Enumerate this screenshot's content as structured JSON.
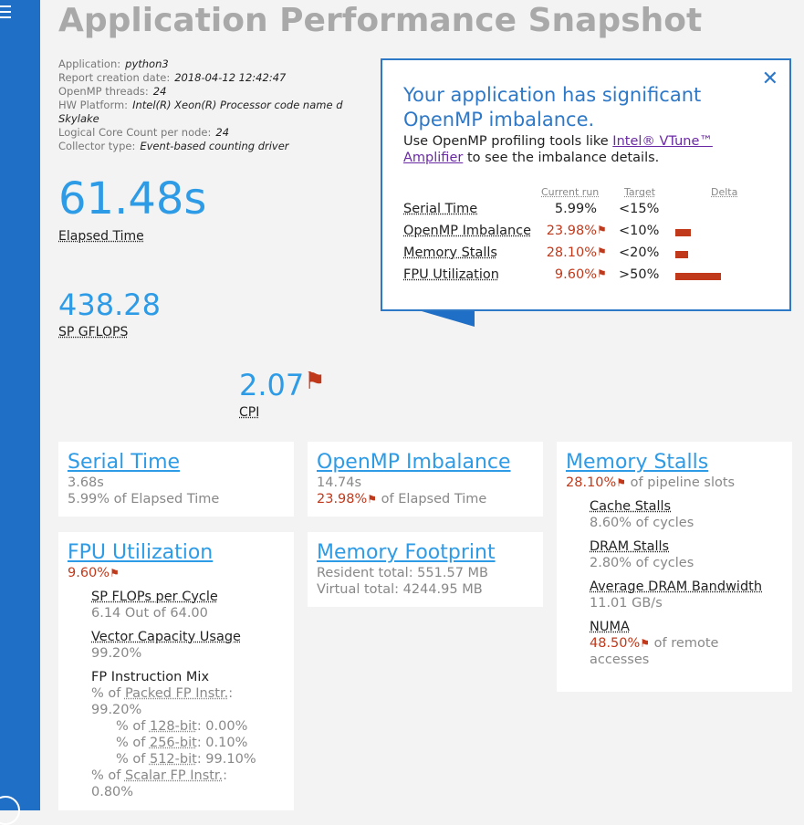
{
  "title": "Application Performance Snapshot",
  "meta": [
    {
      "key": "Application:",
      "value": "python3"
    },
    {
      "key": "Report creation date:",
      "value": "2018-04-12 12:42:47"
    },
    {
      "key": "OpenMP threads:",
      "value": "24"
    },
    {
      "key": "HW Platform:",
      "value": "Intel(R) Xeon(R) Processor code name d Skylake"
    },
    {
      "key": "Logical Core Count per node:",
      "value": "24"
    },
    {
      "key": "Collector type:",
      "value": "Event-based counting driver"
    }
  ],
  "elapsed": {
    "value": "61.48s",
    "label": "Elapsed Time"
  },
  "gflops": {
    "value": "438.28",
    "label": "SP GFLOPS"
  },
  "cpi": {
    "value": "2.07",
    "label": "CPI"
  },
  "serial": {
    "title": "Serial Time",
    "l1": "3.68s",
    "l2": "5.99% of Elapsed Time"
  },
  "omp": {
    "title": "OpenMP Imbalance",
    "l1": "14.74s",
    "pct": "23.98%",
    "suffix": "of Elapsed Time"
  },
  "memstalls": {
    "title": "Memory Stalls",
    "pct": "28.10%",
    "suffix": "of pipeline slots",
    "cache_label": "Cache Stalls",
    "cache_value": "8.60% of cycles",
    "dram_label": "DRAM Stalls",
    "dram_value": "2.80% of cycles",
    "bw_label": "Average DRAM Bandwidth",
    "bw_value": "11.01 GB/s",
    "numa_label": "NUMA",
    "numa_pct": "48.50%",
    "numa_suffix": "of remote",
    "numa_suffix2": "accesses"
  },
  "fpu": {
    "title": "FPU Utilization",
    "pct": "9.60%",
    "flops_label": "SP FLOPs per Cycle",
    "flops_value": "6.14 Out of 64.00",
    "vec_label": "Vector Capacity Usage",
    "vec_value": "99.20%",
    "mix_label": "FP Instruction Mix",
    "packed_prefix": "% of",
    "packed_label": "Packed FP Instr.",
    "packed_colon": ":",
    "packed_value": "99.20%",
    "b128_prefix": "% of",
    "b128_label": "128-bit",
    "b128_value": ": 0.00%",
    "b256_prefix": "% of",
    "b256_label": "256-bit",
    "b256_value": ": 0.10%",
    "b512_prefix": "% of",
    "b512_label": "512-bit",
    "b512_value": ": 99.10%",
    "scalar_prefix": "% of",
    "scalar_label": "Scalar FP Instr.",
    "scalar_colon": ":",
    "scalar_value": "0.80%"
  },
  "footprint": {
    "title": "Memory Footprint",
    "resident": "Resident total: 551.57 MB",
    "virtual": "Virtual total: 4244.95 MB"
  },
  "popup": {
    "heading": "Your application has significant OpenMP imbalance.",
    "desc_prefix": "Use OpenMP profiling tools like",
    "link": "Intel® VTune™ Amplifier",
    "desc_suffix": "to see the imbalance details.",
    "col_current": "Current run",
    "col_target": "Target",
    "col_delta": "Delta",
    "rows": [
      {
        "name": "Serial Time",
        "current": "5.99%",
        "target": "<15%",
        "flagged": false,
        "delta": 0
      },
      {
        "name": "OpenMP Imbalance",
        "current": "23.98%",
        "target": "<10%",
        "flagged": true,
        "delta": 13.98
      },
      {
        "name": "Memory Stalls",
        "current": "28.10%",
        "target": "<20%",
        "flagged": true,
        "delta": 8.1
      },
      {
        "name": "FPU Utilization",
        "current": "9.60%",
        "target": ">50%",
        "flagged": true,
        "delta": 40.4
      }
    ]
  },
  "colors": {
    "accent": "#2e9be6",
    "sidebar": "#1f6fc7",
    "warning": "#c0391b"
  }
}
